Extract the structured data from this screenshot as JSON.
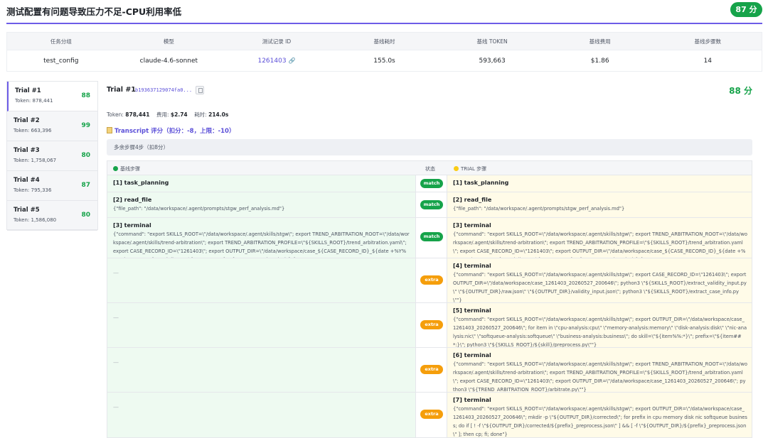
{
  "page": {
    "title": "测试配置有问题导致压力不足-CPU利用率低",
    "score": "87 分"
  },
  "summary": {
    "headers": [
      "任务分组",
      "模型",
      "测试记录 ID",
      "基线耗时",
      "基线 TOKEN",
      "基线费用",
      "基线步骤数"
    ],
    "values": {
      "group": "test_config",
      "model": "claude-4.6-sonnet",
      "record_id": "1261403",
      "link_icon": "link-icon",
      "duration": "155.0s",
      "tokens": "593,663",
      "cost": "$1.86",
      "steps": "14"
    }
  },
  "trials": [
    {
      "name": "Trial #1",
      "token": "Token: 878,441",
      "score": "88"
    },
    {
      "name": "Trial #2",
      "token": "Token: 663,396",
      "score": "99"
    },
    {
      "name": "Trial #3",
      "token": "Token: 1,758,067",
      "score": "80"
    },
    {
      "name": "Trial #4",
      "token": "Token: 795,336",
      "score": "87"
    },
    {
      "name": "Trial #5",
      "token": "Token: 1,586,080",
      "score": "80"
    }
  ],
  "detail": {
    "title": "Trial #1",
    "hash": "b193637129074fa0...",
    "score": "88 分",
    "meta": {
      "token_label": "Token:",
      "token_value": "878,441",
      "cost_label": "费用:",
      "cost_value": "$2.74",
      "time_label": "耗时:",
      "time_value": "214.0s"
    },
    "transcript": "Transcript 评分（扣分：-8，上限：-10）",
    "extra_note": "多余步骤4步（扣8分）",
    "columns": {
      "baseline": "基线步骤",
      "status": "状态",
      "trial": "TRIAL 步骤"
    },
    "steps": [
      {
        "status": "match",
        "baseline_title": "[1] task_planning",
        "baseline_args": "",
        "trial_title": "[1] task_planning",
        "trial_args": ""
      },
      {
        "status": "match",
        "baseline_title": "[2] read_file",
        "baseline_args": "{\"file_path\": \"/data/workspace/.agent/prompts/stgw_perf_analysis.md\"}",
        "trial_title": "[2] read_file",
        "trial_args": "{\"file_path\": \"/data/workspace/.agent/prompts/stgw_perf_analysis.md\"}"
      },
      {
        "status": "match",
        "baseline_title": "[3] terminal",
        "baseline_args": "{\"command\": \"export SKILLS_ROOT=\\\"/data/workspace/.agent/skills/stgw\\\"; export TREND_ARBITRATION_ROOT=\\\"/data/workspace/.agent/skills/trend-arbitration\\\"; export TREND_ARBITRATION_PROFILE=\\\"${SKILLS_ROOT}/trend_arbitration.yaml\\\"; export CASE_RECORD_ID=\\\"1261403\\\"; export OUTPUT_DIR=\\\"/data/workspace/case_${CASE_RECORD_ID}_${date +%Y%m%d_%H%M%S}\\\"; mkdir -p \\\"${OUTPUT_DIR}\\\"/{raw,corrected,analysis}\"}",
        "trial_title": "[3] terminal",
        "trial_args": "{\"command\": \"export SKILLS_ROOT=\\\"/data/workspace/.agent/skills/stgw\\\"; export TREND_ARBITRATION_ROOT=\\\"/data/workspace/.agent/skills/trend-arbitration\\\"; export TREND_ARBITRATION_PROFILE=\\\"${SKILLS_ROOT}/trend_arbitration.yaml\\\"; export CASE_RECORD_ID=\\\"1261403\\\"; export OUTPUT_DIR=\\\"/data/workspace/case_${CASE_RECORD_ID}_${date +%Y%m%d_%H%M%S}\\\"; mkdir -p \\\"${OUTPUT_DIR}\\\"/{raw,corrected,analysis}\"}"
      },
      {
        "status": "extra",
        "baseline_title": "",
        "baseline_args": "—",
        "trial_title": "[4] terminal",
        "trial_args": "{\"command\": \"export SKILLS_ROOT=\\\"/data/workspace/.agent/skills/stgw\\\"; export CASE_RECORD_ID=\\\"1261403\\\"; export OUTPUT_DIR=\\\"/data/workspace/case_1261403_20260527_200646\\\"; python3 \\\"${SKILLS_ROOT}/extract_validity_input.py\\\" \\\"${OUTPUT_DIR}/raw.json\\\" \\\"${OUTPUT_DIR}/validity_input.json\\\"; python3 \\\"${SKILLS_ROOT}/extract_case_info.py\\\"\"}"
      },
      {
        "status": "extra",
        "baseline_title": "",
        "baseline_args": "—",
        "trial_title": "[5] terminal",
        "trial_args": "{\"command\": \"export SKILLS_ROOT=\\\"/data/workspace/.agent/skills/stgw\\\"; export OUTPUT_DIR=\\\"/data/workspace/case_1261403_20260527_200646\\\"; for item in \\\"cpu-analysis:cpu\\\" \\\"memory-analysis:memory\\\" \\\"disk-analysis:disk\\\" \\\"nic-analysis:nic\\\" \\\"softqueue-analysis:softqueue\\\" \\\"business-analysis:business\\\"; do skill=\\\"${item%%:*}\\\"; prefix=\\\"${item##*:}\\\"; python3 \\\"${SKILLS_ROOT}/${skill}/preprocess.py\\\"\"}"
      },
      {
        "status": "extra",
        "baseline_title": "",
        "baseline_args": "—",
        "trial_title": "[6] terminal",
        "trial_args": "{\"command\": \"export SKILLS_ROOT=\\\"/data/workspace/.agent/skills/stgw\\\"; export TREND_ARBITRATION_ROOT=\\\"/data/workspace/.agent/skills/trend-arbitration\\\"; export TREND_ARBITRATION_PROFILE=\\\"${SKILLS_ROOT}/trend_arbitration.yaml\\\"; export CASE_RECORD_ID=\\\"1261403\\\"; export OUTPUT_DIR=\\\"/data/workspace/case_1261403_20260527_200646\\\"; python3 \\\"${TREND_ARBITRATION_ROOT}/arbitrate.py\\\"\"}"
      },
      {
        "status": "extra",
        "baseline_title": "",
        "baseline_args": "—",
        "trial_title": "[7] terminal",
        "trial_args": "{\"command\": \"export SKILLS_ROOT=\\\"/data/workspace/.agent/skills/stgw\\\"; export OUTPUT_DIR=\\\"/data/workspace/case_1261403_20260527_200646\\\"; mkdir -p \\\"${OUTPUT_DIR}/corrected\\\"; for prefix in cpu memory disk nic softqueue business; do if [ ! -f \\\"${OUTPUT_DIR}/corrected/${prefix}_preprocess.json\\\" ] && [ -f \\\"${OUTPUT_DIR}/${prefix}_preprocess.json\\\" ]; then cp; fi; done\"}"
      }
    ]
  }
}
